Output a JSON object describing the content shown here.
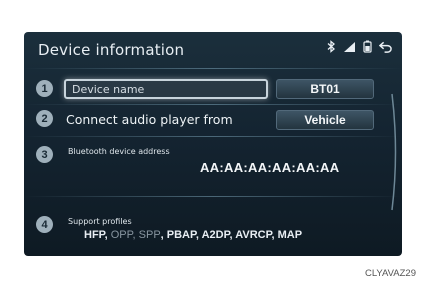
{
  "screen": {
    "title": "Device information",
    "status_icons": [
      "bluetooth-icon",
      "signal-icon",
      "battery-icon",
      "back-icon"
    ]
  },
  "rows": [
    {
      "number": "1",
      "label": "Device name",
      "value": "BT01"
    },
    {
      "number": "2",
      "label": "Connect audio player from",
      "value": "Vehicle"
    },
    {
      "number": "3",
      "label": "Bluetooth device address",
      "value": "AA:AA:AA:AA:AA:AA"
    },
    {
      "number": "4",
      "label": "Support profiles"
    }
  ],
  "profiles": {
    "first": "HFP,",
    "obscured_1": "OPP",
    "obscured_2": "SPP",
    "rest": ", PBAP, A2DP, AVRCP, MAP"
  },
  "caption": "CLYAVAZ29",
  "colors": {
    "screen_bg": "#142431",
    "accent_badge": "#9fb0bb",
    "text": "#eef3f6"
  }
}
